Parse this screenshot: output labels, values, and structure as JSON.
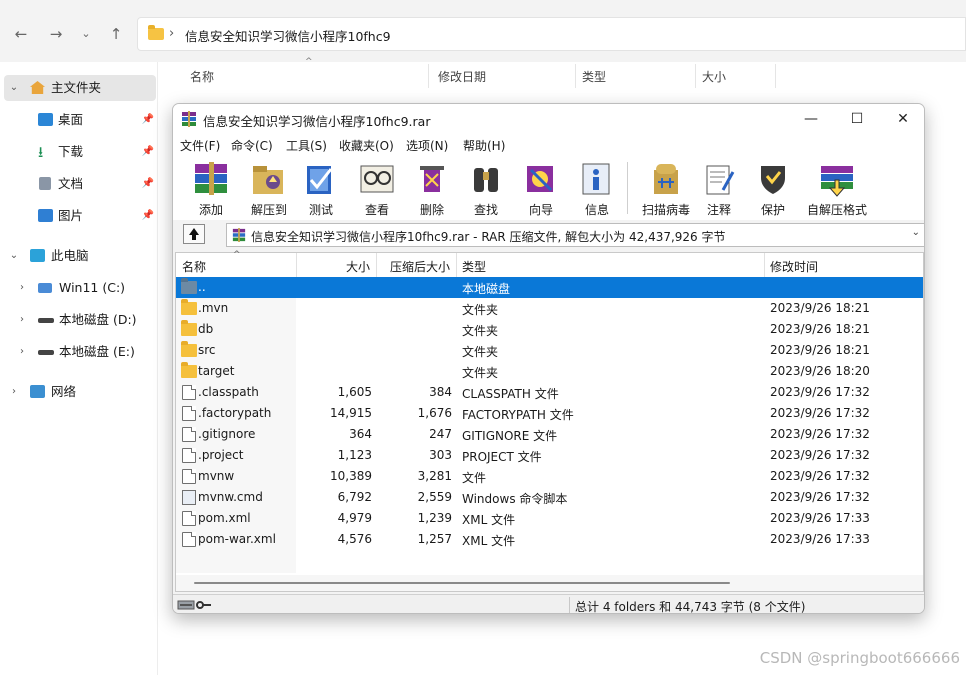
{
  "explorer": {
    "address_path": "信息安全知识学习微信小程序10fhc9",
    "columns": [
      "名称",
      "修改日期",
      "类型",
      "大小"
    ],
    "sidebar": [
      {
        "label": "主文件夹",
        "icon": "home-icon"
      },
      {
        "label": "桌面",
        "icon": "desktop-icon"
      },
      {
        "label": "下载",
        "icon": "download-icon"
      },
      {
        "label": "文档",
        "icon": "documents-icon"
      },
      {
        "label": "图片",
        "icon": "pictures-icon"
      },
      {
        "label": "此电脑",
        "icon": "this-pc-icon"
      },
      {
        "label": "Win11 (C:)",
        "icon": "windows-drive-icon"
      },
      {
        "label": "本地磁盘 (D:)",
        "icon": "drive-icon"
      },
      {
        "label": "本地磁盘 (E:)",
        "icon": "drive-icon"
      },
      {
        "label": "网络",
        "icon": "network-icon"
      }
    ]
  },
  "rar": {
    "title": "信息安全知识学习微信小程序10fhc9.rar",
    "menu": [
      "文件(F)",
      "命令(C)",
      "工具(S)",
      "收藏夹(O)",
      "选项(N)",
      "帮助(H)"
    ],
    "toolbar": [
      "添加",
      "解压到",
      "测试",
      "查看",
      "删除",
      "查找",
      "向导",
      "信息",
      "扫描病毒",
      "注释",
      "保护",
      "自解压格式"
    ],
    "path_text": "信息安全知识学习微信小程序10fhc9.rar - RAR 压缩文件, 解包大小为 42,437,926 字节",
    "columns": {
      "name": "名称",
      "size": "大小",
      "packed": "压缩后大小",
      "type": "类型",
      "modified": "修改时间"
    },
    "rows": [
      {
        "name": "..",
        "size": "",
        "packed": "",
        "type": "本地磁盘",
        "modified": "",
        "kind": "parent"
      },
      {
        "name": ".mvn",
        "size": "",
        "packed": "",
        "type": "文件夹",
        "modified": "2023/9/26 18:21",
        "kind": "folder"
      },
      {
        "name": "db",
        "size": "",
        "packed": "",
        "type": "文件夹",
        "modified": "2023/9/26 18:21",
        "kind": "folder"
      },
      {
        "name": "src",
        "size": "",
        "packed": "",
        "type": "文件夹",
        "modified": "2023/9/26 18:21",
        "kind": "folder"
      },
      {
        "name": "target",
        "size": "",
        "packed": "",
        "type": "文件夹",
        "modified": "2023/9/26 18:20",
        "kind": "folder"
      },
      {
        "name": ".classpath",
        "size": "1,605",
        "packed": "384",
        "type": "CLASSPATH 文件",
        "modified": "2023/9/26 17:32",
        "kind": "file"
      },
      {
        "name": ".factorypath",
        "size": "14,915",
        "packed": "1,676",
        "type": "FACTORYPATH 文件",
        "modified": "2023/9/26 17:32",
        "kind": "file"
      },
      {
        "name": ".gitignore",
        "size": "364",
        "packed": "247",
        "type": "GITIGNORE 文件",
        "modified": "2023/9/26 17:32",
        "kind": "file"
      },
      {
        "name": ".project",
        "size": "1,123",
        "packed": "303",
        "type": "PROJECT 文件",
        "modified": "2023/9/26 17:32",
        "kind": "file"
      },
      {
        "name": "mvnw",
        "size": "10,389",
        "packed": "3,281",
        "type": "文件",
        "modified": "2023/9/26 17:32",
        "kind": "file"
      },
      {
        "name": "mvnw.cmd",
        "size": "6,792",
        "packed": "2,559",
        "type": "Windows 命令脚本",
        "modified": "2023/9/26 17:32",
        "kind": "cmd"
      },
      {
        "name": "pom.xml",
        "size": "4,979",
        "packed": "1,239",
        "type": "XML 文件",
        "modified": "2023/9/26 17:33",
        "kind": "file"
      },
      {
        "name": "pom-war.xml",
        "size": "4,576",
        "packed": "1,257",
        "type": "XML 文件",
        "modified": "2023/9/26 17:33",
        "kind": "file"
      }
    ],
    "status_text": "总计 4 folders 和 44,743 字节 (8 个文件)"
  },
  "watermark": "CSDN @springboot666666",
  "colors": {
    "selection": "#0a78d7",
    "folder": "#f5c03c"
  }
}
